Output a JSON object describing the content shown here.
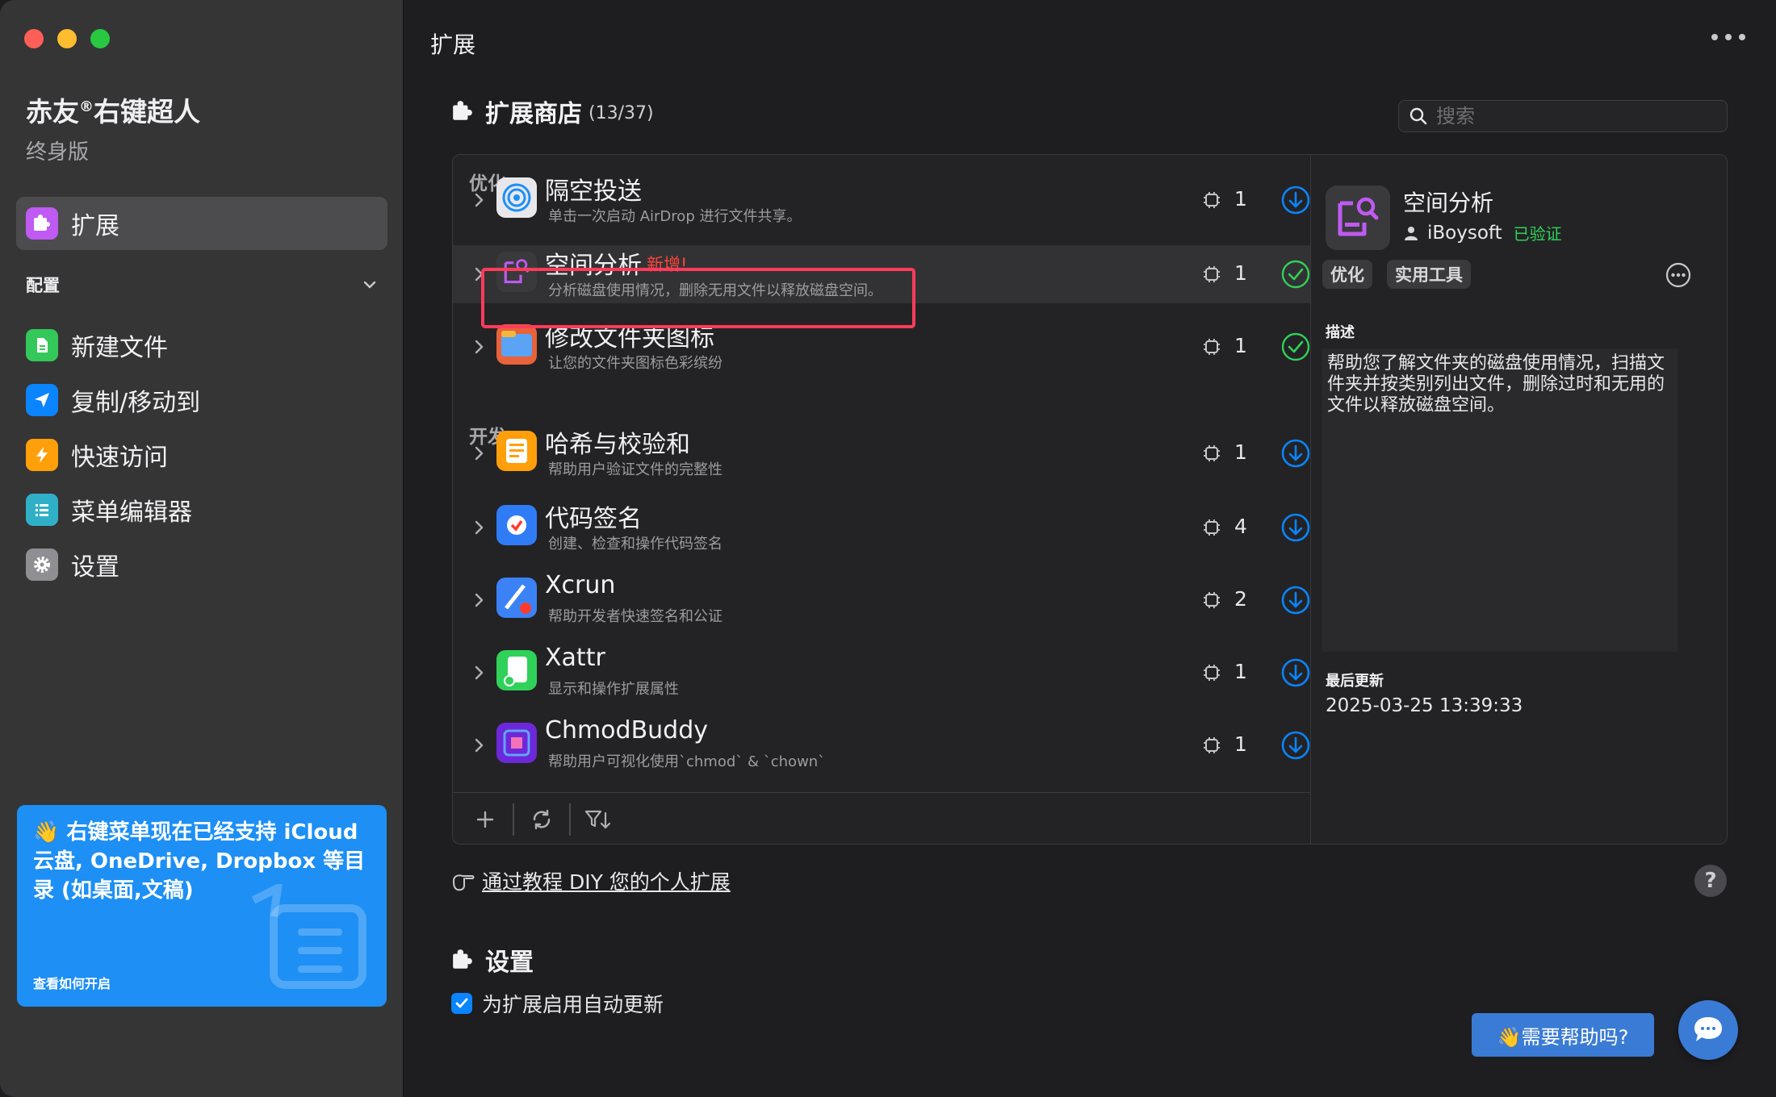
{
  "sidebar": {
    "app_name": "赤友",
    "app_name_mark": "®",
    "app_name_rest": "右键超人",
    "edition": "终身版",
    "active_item": "扩展",
    "config_label": "配置",
    "items": [
      {
        "label": "新建文件",
        "icon": "new-file-icon",
        "color": "#34c759"
      },
      {
        "label": "复制/移动到",
        "icon": "paper-plane-icon",
        "color": "#0a84ff"
      },
      {
        "label": "快速访问",
        "icon": "lightning-icon",
        "color": "#ff9f0a"
      },
      {
        "label": "菜单编辑器",
        "icon": "list-icon",
        "color": "#30b0c7"
      },
      {
        "label": "设置",
        "icon": "gear-icon",
        "color": "#8e8e93"
      }
    ],
    "promo": {
      "emoji": "👋",
      "text": "右键菜单现在已经支持 iCloud 云盘, OneDrive, Dropbox 等目录 (如桌面,文稿)",
      "link": "查看如何开启"
    }
  },
  "main": {
    "title": "扩展",
    "store_title": "扩展商店",
    "store_count": "(13/37)",
    "search_placeholder": "搜索",
    "sections": {
      "optimize": "优化",
      "develop": "开发"
    },
    "extensions": [
      {
        "title": "隔空投送",
        "desc": "单击一次启动 AirDrop 进行文件共享。",
        "count": "1",
        "status": "download",
        "new": ""
      },
      {
        "title": "空间分析",
        "desc": "分析磁盘使用情况，删除无用文件以释放磁盘空间。",
        "count": "1",
        "status": "installed",
        "new": "新增!"
      },
      {
        "title": "修改文件夹图标",
        "desc": "让您的文件夹图标色彩缤纷",
        "count": "1",
        "status": "installed",
        "new": ""
      },
      {
        "title": "哈希与校验和",
        "desc": "帮助用户验证文件的完整性",
        "count": "1",
        "status": "download",
        "new": ""
      },
      {
        "title": "代码签名",
        "desc": "创建、检查和操作代码签名",
        "count": "4",
        "status": "download",
        "new": ""
      },
      {
        "title": "Xcrun",
        "desc": "帮助开发者快速签名和公证",
        "count": "2",
        "status": "download",
        "new": ""
      },
      {
        "title": "Xattr",
        "desc": "显示和操作扩展属性",
        "count": "1",
        "status": "download",
        "new": ""
      },
      {
        "title": "ChmodBuddy",
        "desc": "帮助用户可视化使用`chmod` & `chown`",
        "count": "1",
        "status": "download",
        "new": ""
      }
    ],
    "detail": {
      "name": "空间分析",
      "author": "iBoysoft",
      "verified": "已验证",
      "tags": [
        "优化",
        "实用工具"
      ],
      "desc_label": "描述",
      "desc": "帮助您了解文件夹的磁盘使用情况，扫描文件夹并按类别列出文件，删除过时和无用的文件以释放磁盘空间。",
      "updated_label": "最后更新",
      "updated": "2025-03-25 13:39:33"
    },
    "diy_link": "通过教程 DIY 您的个人扩展",
    "help_q": "?",
    "settings_title": "设置",
    "auto_update_label": "为扩展启用自动更新",
    "need_help": "👋需要帮助吗?"
  },
  "colors": {
    "accent": "#0a84ff",
    "installed": "#30d158",
    "new_badge": "#ff453a",
    "highlight_border": "#ff3b5c",
    "promo_bg": "#1d8ff5"
  }
}
